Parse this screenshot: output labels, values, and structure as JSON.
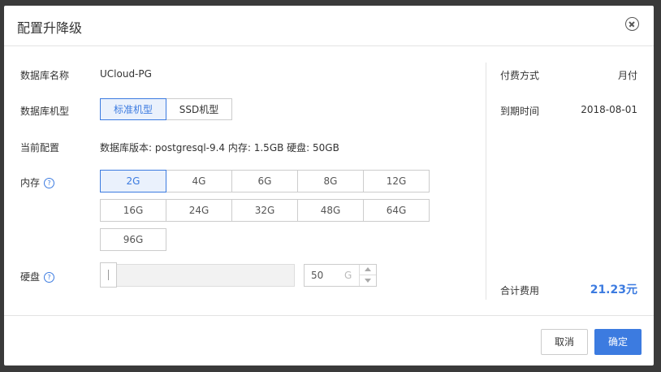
{
  "dialog": {
    "title": "配置升降级"
  },
  "form": {
    "db_name_label": "数据库名称",
    "db_name_value": "UCloud-PG",
    "db_type_label": "数据库机型",
    "db_types": [
      "标准机型",
      "SSD机型"
    ],
    "db_type_selected": "标准机型",
    "current_config_label": "当前配置",
    "current_config_value": "数据库版本: postgresql-9.4 内存: 1.5GB 硬盘: 50GB",
    "memory_label": "内存",
    "memory_options": [
      "2G",
      "4G",
      "6G",
      "8G",
      "12G",
      "16G",
      "24G",
      "32G",
      "48G",
      "64G",
      "96G"
    ],
    "memory_selected": "2G",
    "disk_label": "硬盘",
    "disk_value": "50",
    "disk_unit": "G",
    "help_icon_glyph": "?"
  },
  "summary": {
    "billing_label": "付费方式",
    "billing_value": "月付",
    "expire_label": "到期时间",
    "expire_value": "2018-08-01",
    "total_label": "合计费用",
    "total_value": "21.23元"
  },
  "footer": {
    "cancel_label": "取消",
    "confirm_label": "确定"
  },
  "colors": {
    "accent": "#3c7be0",
    "border": "#cccccc",
    "text": "#333333"
  },
  "icons": {
    "close": "close-circle-icon",
    "help": "question-circle-icon"
  }
}
